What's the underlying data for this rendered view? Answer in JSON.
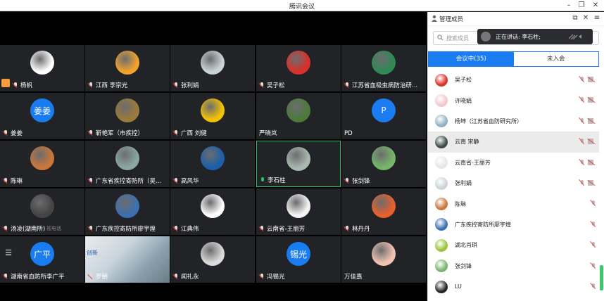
{
  "window": {
    "title": "腾讯会议"
  },
  "panel": {
    "title": "管理成员",
    "search_placeholder": "搜索成员",
    "speaking": "正在讲话: 李石柱;",
    "tabs": [
      {
        "label": "会议中(35)"
      },
      {
        "label": "未入会"
      }
    ]
  },
  "tiles": [
    {
      "name": "杨帆",
      "avatar": "photo-avatar",
      "color": "#ffffff",
      "host": true
    },
    {
      "name": "江西 李宗光",
      "avatar": "photo-avatar",
      "color": "#f1a32c"
    },
    {
      "name": "张利娟",
      "avatar": "photo-avatar",
      "color": "#c9d3d8"
    },
    {
      "name": "吴子松",
      "avatar": "photo-avatar",
      "color": "#d9302a"
    },
    {
      "name": "江苏省血吸虫病防治研...",
      "avatar": "photo-avatar",
      "color": "#2d8a55"
    },
    {
      "name": "姜姜",
      "avatar": "text-avatar",
      "label": "姜姜"
    },
    {
      "name": "靳艳军（市疾控）",
      "avatar": "photo-avatar",
      "color": "#9b7a3a"
    },
    {
      "name": "广西 刘健",
      "avatar": "photo-avatar",
      "color": "#f2c200"
    },
    {
      "name": "严晓岚",
      "avatar": "photo-avatar",
      "color": "#4d7a3a"
    },
    {
      "name": "PD",
      "avatar": "text-avatar",
      "label": "P"
    },
    {
      "name": "陈琳",
      "avatar": "photo-avatar",
      "color": "#c9763a"
    },
    {
      "name": "广东省疾控寄防所（吴...",
      "avatar": "photo-avatar",
      "color": "#8ba6a0"
    },
    {
      "name": "高风华",
      "avatar": "photo-avatar",
      "color": "#1b5fa8"
    },
    {
      "name": "李石柱",
      "avatar": "photo-avatar",
      "color": "#a9b8b0",
      "active": true
    },
    {
      "name": "张剑锋",
      "avatar": "photo-avatar",
      "color": "#76b56a"
    },
    {
      "name": "汤凌(湖南所)",
      "avatar": "photo-avatar",
      "color": "#444444",
      "overlay": "视电话"
    },
    {
      "name": "广东疾控寄防所廖宇煌",
      "avatar": "photo-avatar",
      "color": "#3c6fb0"
    },
    {
      "name": "江典伟",
      "avatar": "photo-avatar",
      "color": "#ffffff"
    },
    {
      "name": "云南省-王丽芳",
      "avatar": "photo-avatar",
      "color": "#f4f4f4"
    },
    {
      "name": "林丹丹",
      "avatar": "photo-avatar",
      "color": "#e8602c"
    },
    {
      "name": "湖南省血防所李广平",
      "avatar": "text-avatar",
      "label": "广平"
    },
    {
      "name": "罗朝",
      "avatar": "video",
      "label": "创新"
    },
    {
      "name": "闻礼永",
      "avatar": "photo-avatar",
      "color": "#dadada"
    },
    {
      "name": "冯锡光",
      "avatar": "text-avatar",
      "label": "锡光"
    },
    {
      "name": "万佳嘉",
      "avatar": "photo-avatar",
      "color": "#f0c2b0"
    }
  ],
  "members": [
    {
      "name": "吴子松",
      "color": "#d9302a",
      "cam": true
    },
    {
      "name": "许晓娟",
      "color": "#f3c7cf",
      "cam": true
    },
    {
      "name": "杨坤（江苏省血防研究所）",
      "color": "#8fb0c0",
      "cam": true
    },
    {
      "name": "云南 宋静",
      "color": "#3a4a46",
      "cam": true,
      "highlight": true
    },
    {
      "name": "云南省-王丽芳",
      "color": "#e6e6e6",
      "cam": true
    },
    {
      "name": "张利娟",
      "color": "#c9d3d8",
      "cam": true
    },
    {
      "name": "陈琳",
      "color": "#c9763a",
      "cam": false
    },
    {
      "name": "广东疾控寄防所廖宇煌",
      "color": "#3c6fb0",
      "cam": false
    },
    {
      "name": "湖北肖琪",
      "color": "#9ac43a",
      "cam": false
    },
    {
      "name": "张剑锋",
      "color": "#76b56a",
      "cam": false
    },
    {
      "name": "LU",
      "color": "#222222",
      "cam": false
    }
  ]
}
